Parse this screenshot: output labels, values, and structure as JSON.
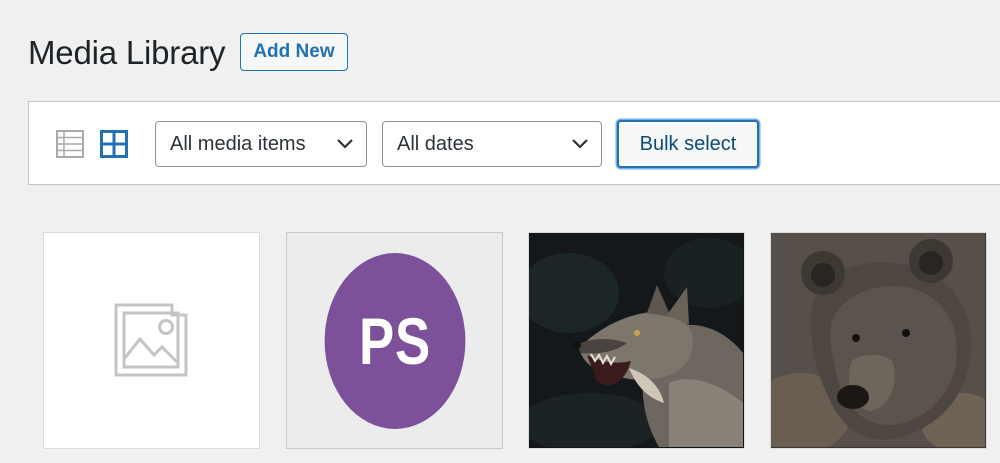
{
  "page": {
    "title": "Media Library",
    "add_new_label": "Add New"
  },
  "toolbar": {
    "view_modes": [
      {
        "name": "list",
        "icon": "list-view-icon",
        "active": false
      },
      {
        "name": "grid",
        "icon": "grid-view-icon",
        "active": true
      }
    ],
    "media_filter": {
      "selected": "All media items"
    },
    "date_filter": {
      "selected": "All dates"
    },
    "bulk_select_label": "Bulk select"
  },
  "colors": {
    "accent": "#2271b1",
    "background": "#f0f0f1",
    "ps_logo_bg": "#7c5199"
  },
  "attachments": [
    {
      "kind": "placeholder",
      "icon": "image-placeholder-icon"
    },
    {
      "kind": "logo",
      "text": "PS"
    },
    {
      "kind": "photo",
      "subject": "wolf"
    },
    {
      "kind": "photo",
      "subject": "bear"
    }
  ]
}
